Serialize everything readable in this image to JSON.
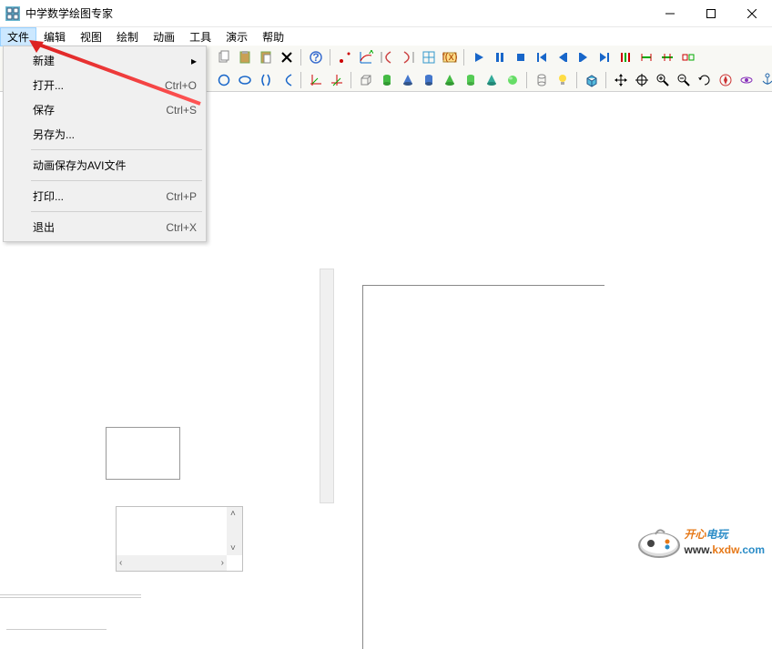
{
  "app": {
    "title": "中学数学绘图专家"
  },
  "menubar": [
    "文件",
    "编辑",
    "视图",
    "绘制",
    "动画",
    "工具",
    "演示",
    "帮助"
  ],
  "active_menu_index": 0,
  "dropdown": {
    "items": [
      {
        "label": "新建",
        "shortcut": "",
        "has_submenu": true
      },
      {
        "label": "打开...",
        "shortcut": "Ctrl+O"
      },
      {
        "label": "保存",
        "shortcut": "Ctrl+S"
      },
      {
        "label": "另存为...",
        "shortcut": ""
      },
      {
        "sep": true
      },
      {
        "label": "动画保存为AVI文件",
        "shortcut": ""
      },
      {
        "sep": true
      },
      {
        "label": "打印...",
        "shortcut": "Ctrl+P"
      },
      {
        "sep": true
      },
      {
        "label": "退出",
        "shortcut": "Ctrl+X"
      }
    ]
  },
  "toolbar": {
    "row1_icons": [
      "copy",
      "paste",
      "clipboard",
      "cut",
      "sep",
      "help",
      "sep",
      "point",
      "line-graph",
      "curve-left",
      "curve-right",
      "grid",
      "func",
      "sep",
      "play",
      "pause",
      "stop",
      "first",
      "prev",
      "next",
      "last",
      "loop",
      "stretch-h",
      "stretch-v",
      "repeat"
    ],
    "row2_icons": [
      "circle",
      "ellipse",
      "cross",
      "angle",
      "sep",
      "axes",
      "axes-arrow",
      "sep",
      "box",
      "cyl-green",
      "cone-blue",
      "cyl-blue",
      "cone-green",
      "cyl-green2",
      "cone-teal",
      "sphere",
      "sep",
      "outline",
      "bulb",
      "sep",
      "cube",
      "sep",
      "move",
      "target",
      "zoom-in",
      "zoom-out",
      "rotate",
      "compass",
      "cursor",
      "hand"
    ]
  },
  "logo": {
    "cn1": "开心",
    "cn2": "电玩",
    "url_pre": "www.",
    "url_mid": "kxdw",
    "url_end": ".com"
  }
}
